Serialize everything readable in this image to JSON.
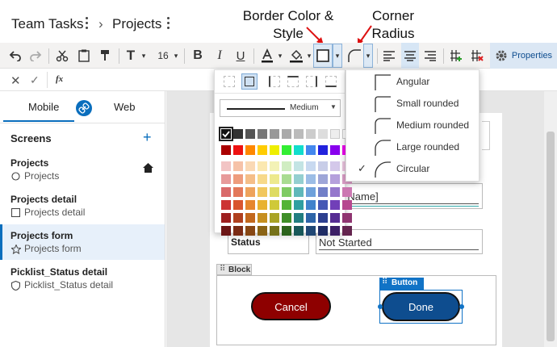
{
  "header": {
    "app_name": "Team Tasks",
    "screen_name": "Projects",
    "callout_border": "Border Color &\nStyle",
    "callout_border_1": "Border Color &",
    "callout_border_2": "Style",
    "callout_radius_1": "Corner",
    "callout_radius_2": "Radius"
  },
  "toolbar": {
    "font_size": "16",
    "properties_label": "Properties"
  },
  "formula": {
    "fx_label": "fx"
  },
  "left": {
    "tab_mobile": "Mobile",
    "tab_web": "Web",
    "screens_title": "Screens",
    "items": [
      {
        "title": "Projects",
        "sub": "Projects"
      },
      {
        "title": "Projects detail",
        "sub": "Projects detail"
      },
      {
        "title": "Projects form",
        "sub": "Projects form"
      },
      {
        "title": "Picklist_Status detail",
        "sub": "Picklist_Status detail"
      }
    ]
  },
  "canvas": {
    "project_name_value": "roject Name]",
    "status_label": "Status",
    "status_value": "Not Started",
    "block_label": "Block",
    "button_tag": "Button",
    "cancel_label": "Cancel",
    "done_label": "Done"
  },
  "border_popup": {
    "weight_label": "Medium"
  },
  "radius_popup": {
    "options": [
      "Angular",
      "Small rounded",
      "Medium rounded",
      "Large rounded",
      "Circular"
    ],
    "selected": "Circular"
  },
  "colors": {
    "accent": "#0a6ebd",
    "cancel_button": "#8e0000",
    "done_button": "#0e4d8f",
    "selection": "#1173c6"
  }
}
